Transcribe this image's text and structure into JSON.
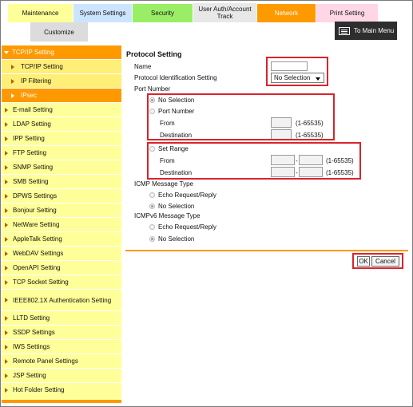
{
  "tabs": {
    "maintenance": "Maintenance",
    "system": "System Settings",
    "security": "Security",
    "user_auth": "User Auth/Account Track",
    "network": "Network",
    "print": "Print Setting"
  },
  "customize": "Customize",
  "main_menu": "To Main Menu",
  "sidebar": {
    "head": "TCP/IP Setting",
    "subs": [
      "TCP/IP Setting",
      "IP Filtering",
      "IPsec"
    ],
    "items": [
      "E-mail Setting",
      "LDAP Setting",
      "IPP Setting",
      "FTP Setting",
      "SNMP Setting",
      "SMB Setting",
      "DPWS Settings",
      "Bonjour Setting",
      "NetWare Setting",
      "AppleTalk Setting",
      "WebDAV Settings",
      "OpenAPI Setting",
      "TCP Socket Setting",
      "IEEE802.1X Authentication Setting",
      "LLTD Setting",
      "SSDP Settings",
      "IWS Settings",
      "Remote Panel Settings",
      "JSP Setting",
      "Hot Folder Setting"
    ]
  },
  "form": {
    "title": "Protocol Setting",
    "name_label": "Name",
    "name_value": "",
    "protocol_label": "Protocol Identification Setting",
    "protocol_value": "No Selection",
    "port_number_label": "Port Number",
    "opt_no_selection": "No Selection",
    "opt_port_number": "Port Number",
    "from_label": "From",
    "destination_label": "Destination",
    "range_hint": "(1-65535)",
    "opt_set_range": "Set Range",
    "range_dash": "-",
    "icmp_label": "ICMP Message Type",
    "icmpv6_label": "ICMPv6 Message Type",
    "echo": "Echo Request/Reply",
    "no_selection": "No Selection"
  },
  "buttons": {
    "ok": "OK",
    "cancel": "Cancel"
  }
}
